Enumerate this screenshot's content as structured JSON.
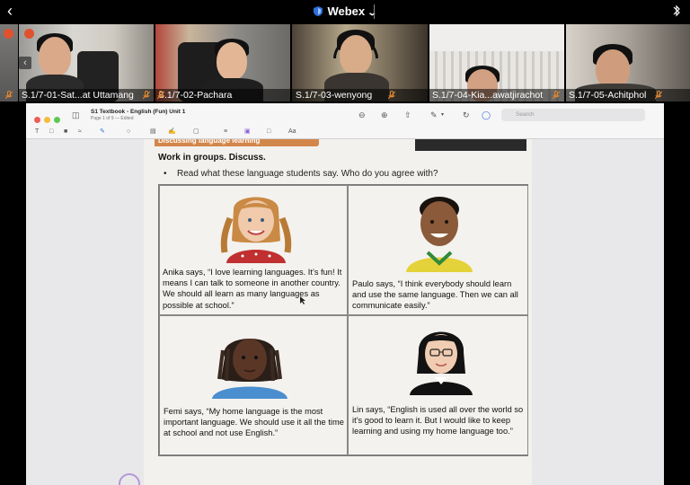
{
  "app": {
    "title": "Webex",
    "brand_color": "#2f6fd8"
  },
  "participants": [
    {
      "name": "S.1/7-01-Sat...at Uttamang"
    },
    {
      "name": "S.1/7-02-Pachara"
    },
    {
      "name": "S.1/7-03-wenyong"
    },
    {
      "name": "S.1/7-04-Kia...awatjirachot"
    },
    {
      "name": "S.1/7-05-Achitphol"
    }
  ],
  "document": {
    "title": "S1 Textbook - English (Fun) Unit 1",
    "subtitle": "Page 1 of 9 — Edited",
    "search_placeholder": "Search",
    "banner_text": "Discussing language learning",
    "heading": "Work in groups. Discuss.",
    "instruction": "Read what these language students say. Who do you agree with?",
    "quotes": [
      {
        "speaker": "Anika",
        "text": "Anika says, “I love learning languages. It’s fun! It means I can talk to someone in another country. We should all learn as many languages as possible at school.”"
      },
      {
        "speaker": "Paulo",
        "text": "Paulo says, “I think everybody should learn and use the same language. Then we can all communicate easily.”"
      },
      {
        "speaker": "Femi",
        "text": "Femi says, “My home language is the most important language. We should use it all the time at school and not use English.”"
      },
      {
        "speaker": "Lin",
        "text": "Lin says, “English is used all over the world so it’s good to learn it. But I would like to keep learning and using my home language too.”"
      }
    ]
  },
  "icons": {
    "back": "chevron-left-icon",
    "bluetooth": "bluetooth-icon",
    "mic_muted": "mic-muted-icon"
  },
  "colors": {
    "mic_muted": "#e0872f",
    "recording": "#e0522e",
    "banner": "#d3864a"
  }
}
